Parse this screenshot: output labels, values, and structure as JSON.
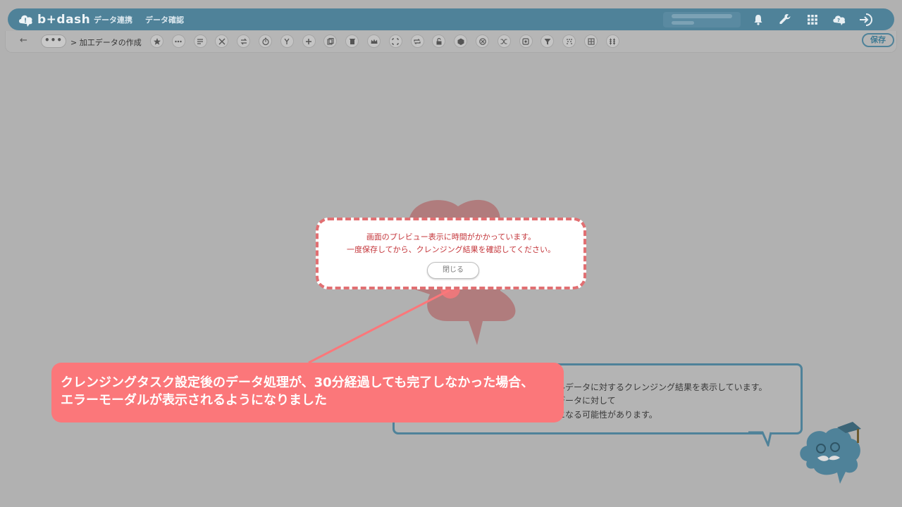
{
  "header": {
    "logo_text": "b+dash",
    "nav": [
      "データ連携",
      "データ確認"
    ]
  },
  "toolbar": {
    "back_symbol": "←",
    "more_symbol": "•••",
    "breadcrumb": "> 加工データの作成",
    "save_label": "保存",
    "tool_icons": [
      "star-icon",
      "ellipsis-icon",
      "text-align-icon",
      "tools-icon",
      "swap-icon",
      "timer-icon",
      "branch-icon",
      "plus-icon",
      "copy-icon",
      "trash-icon",
      "crown-icon",
      "expand-icon",
      "repeat-icon",
      "lock-icon",
      "cube-icon",
      "cancel-icon",
      "shuffle-icon",
      "settings-icon",
      "filter-icon",
      "pattern-icon",
      "grid-icon",
      "columns-icon"
    ]
  },
  "background_panel": {
    "line1": "ルデータに対するクレンジング結果を表示しています。",
    "line2": "データに対して",
    "line3": "になる可能性があります。"
  },
  "modal": {
    "message_line1": "画面のプレビュー表示に時間がかかっています。",
    "message_line2": "一度保存してから、クレンジング結果を確認してください。",
    "close_label": "閉じる"
  },
  "callout": {
    "line1": "クレンジングタスク設定後のデータ処理が、30分経過しても完了しなかった場合、",
    "line2": "エラーモーダルが表示されるようになりました"
  },
  "colors": {
    "brand": "#4f8299",
    "highlight": "#fb777a",
    "modal_text": "#c4353a",
    "overlay": "#b1b1b1"
  }
}
